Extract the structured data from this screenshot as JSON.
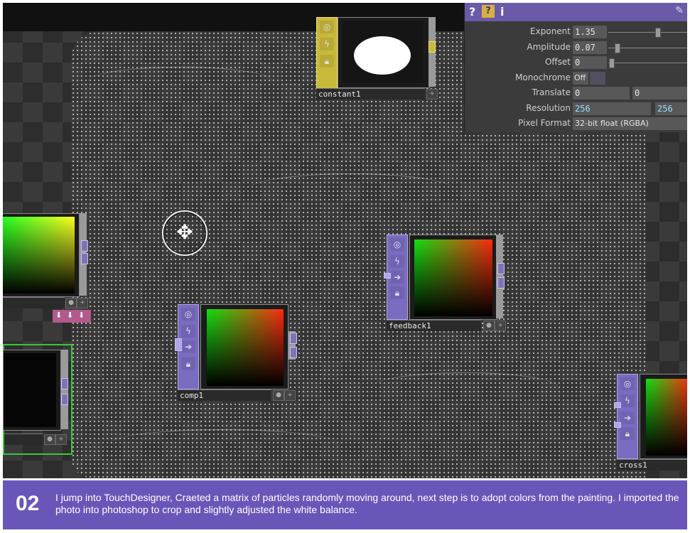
{
  "params": {
    "exponent": {
      "label": "Exponent",
      "value": "1.35"
    },
    "amplitude": {
      "label": "Amplitude",
      "value": "0.07"
    },
    "offset": {
      "label": "Offset",
      "value": "0"
    },
    "monochrome": {
      "label": "Monochrome",
      "value": "Off"
    },
    "translate": {
      "label": "Translate",
      "x": "0",
      "y": "0"
    },
    "resolution": {
      "label": "Resolution",
      "w": "256",
      "h": "256"
    },
    "pixel_format": {
      "label": "Pixel Format",
      "value": "32-bit float (RGBA)"
    }
  },
  "panel_icons": {
    "help": "?",
    "python_help": "?",
    "info": "i",
    "edit": "✎"
  },
  "nodes": {
    "constant1": "constant1",
    "feedback1": "feedback1",
    "comp1": "comp1",
    "cross1": "cross1"
  },
  "caption": {
    "number": "02",
    "text": "I jump into TouchDesigner, Craeted a matrix of particles randomly moving around, next step is to adopt colors from the painting. I imported the photo into photoshop to crop and slightly adjusted the white balance."
  },
  "colors": {
    "accent": "#6a56b8",
    "panel_header": "#6a5aa8",
    "constant_node": "#c8b93a",
    "selected_node": "#37c837"
  }
}
